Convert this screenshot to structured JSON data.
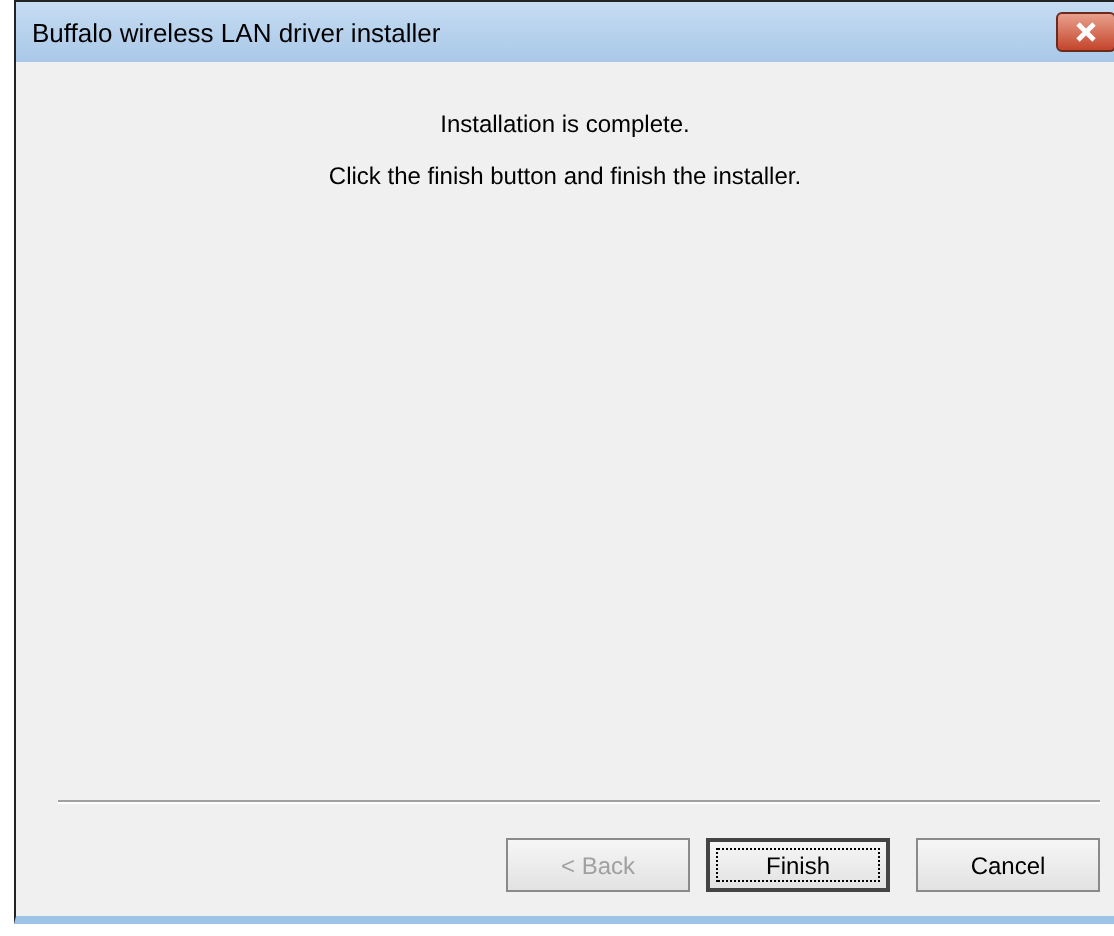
{
  "window": {
    "title": "Buffalo wireless LAN driver installer"
  },
  "messages": [
    "Installation is complete.",
    "Click the finish button and finish the installer."
  ],
  "buttons": [
    {
      "label": "< Back",
      "disabled": true,
      "default": false
    },
    {
      "label": "Finish",
      "disabled": false,
      "default": true
    },
    {
      "label": "Cancel",
      "disabled": false,
      "default": false
    }
  ]
}
